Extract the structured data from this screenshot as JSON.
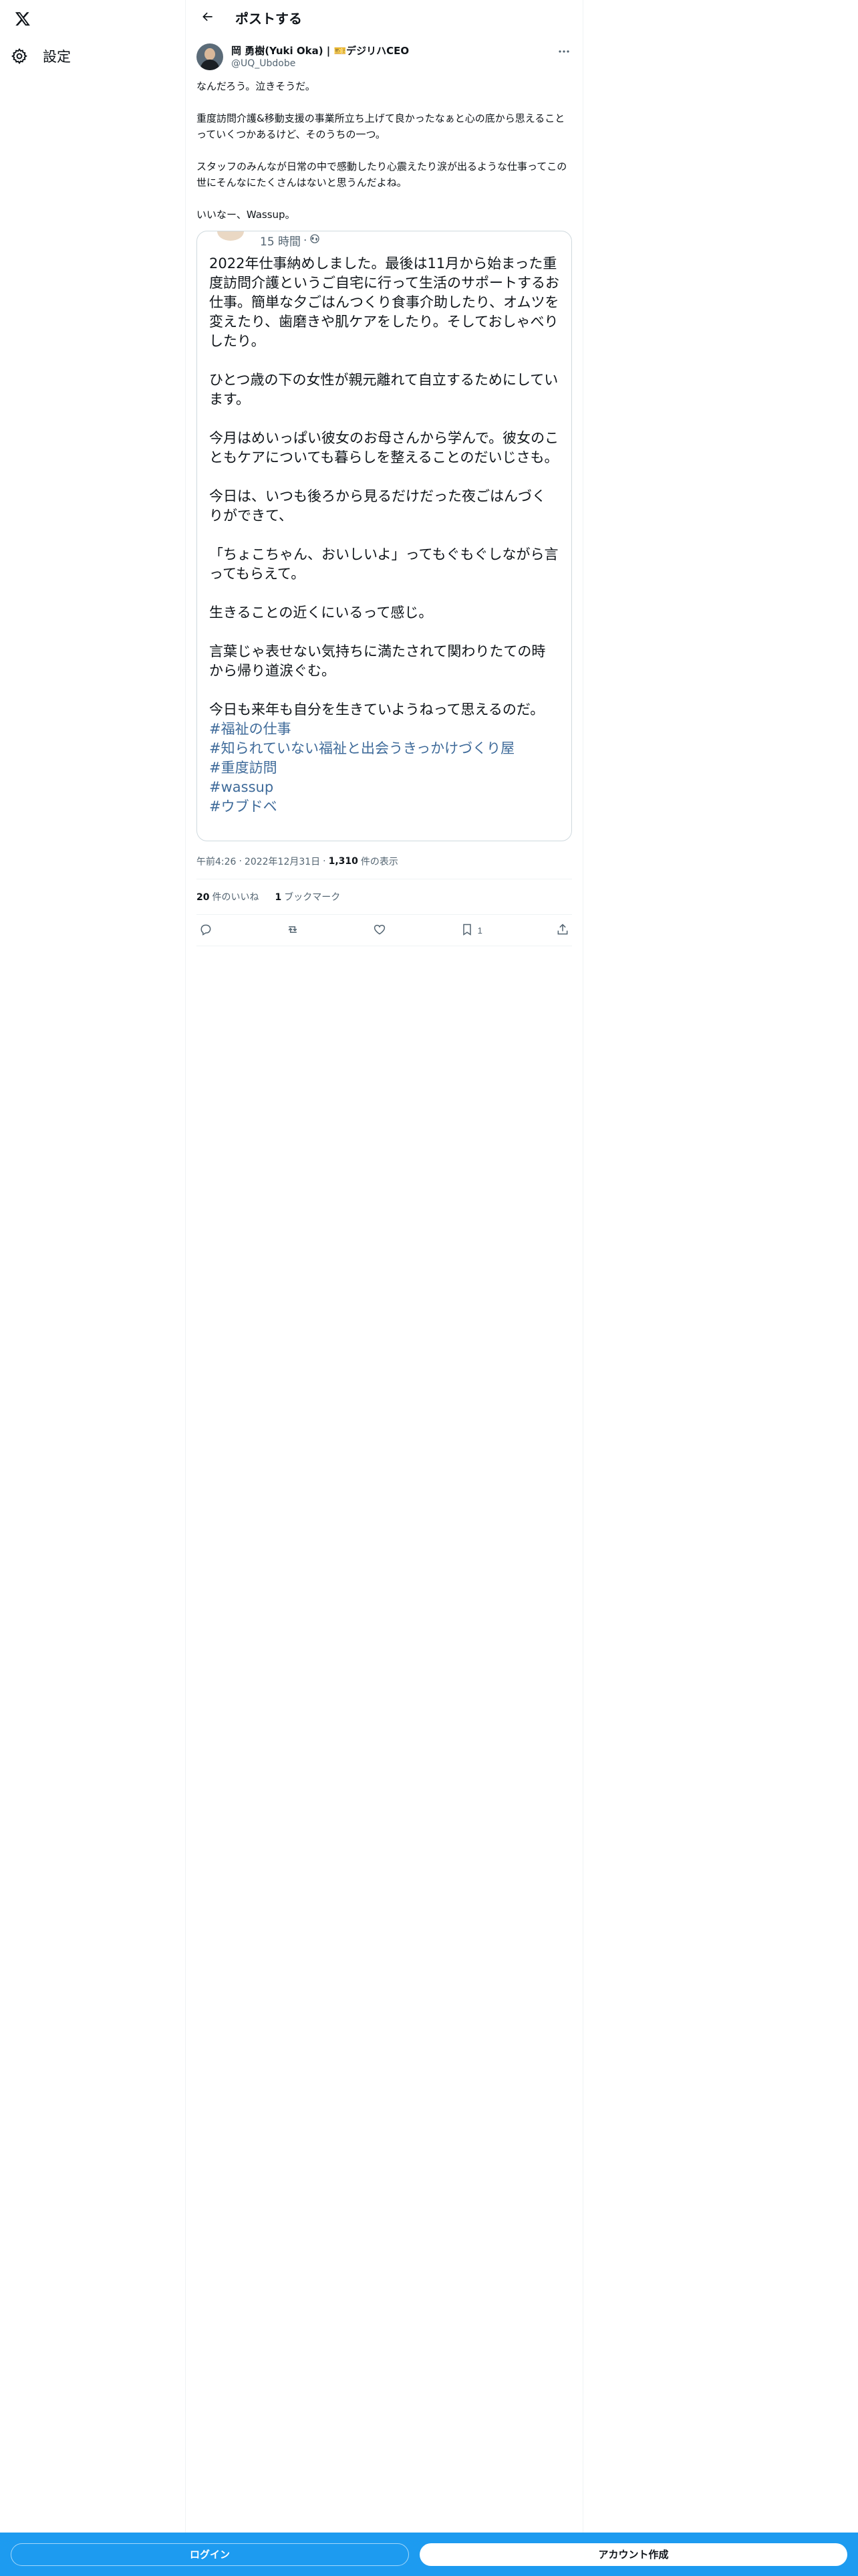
{
  "nav": {
    "logo_icon": "x-logo-icon",
    "settings_icon": "gear-icon",
    "settings_label": "設定"
  },
  "header": {
    "back_icon": "arrow-left-icon",
    "title": "ポストする"
  },
  "post": {
    "author": {
      "display_name": "岡 勇樹(Yuki Oka) | 🎫デジリハCEO",
      "handle": "@UQ_Ubdobe"
    },
    "more_icon": "more-horizontal-icon",
    "text": "なんだろう。泣きそうだ。\n\n重度訪問介護&移動支援の事業所立ち上げて良かったなぁと心の底から思えることっていくつかあるけど、そのうちの一つ。\n\nスタッフのみんなが日常の中で感動したり心震えたり涙が出るような仕事ってこの世にそんなにたくさんはないと思うんだよね。\n\nいいなー、Wassup。",
    "quote": {
      "time": "15 時間",
      "separator": "·",
      "globe_icon": "globe-icon",
      "text": "2022年仕事納めしました。最後は11月から始まった重度訪問介護というご自宅に行って生活のサポートするお仕事。簡単な夕ごはんつくり食事介助したり、オムツを変えたり、歯磨きや肌ケアをしたり。そしておしゃべりしたり。\n\nひとつ歳の下の女性が親元離れて自立するためにしています。\n\n今月はめいっぱい彼女のお母さんから学んで。彼女のこともケアについても暮らしを整えることのだいじさも。\n\n今日は、いつも後ろから見るだけだった夜ごはんづくりができて、\n\n「ちょこちゃん、おいしいよ」ってもぐもぐしながら言ってもらえて。\n\n生きることの近くにいるって感じ。\n\n言葉じゃ表せない気持ちに満たされて関わりたての時から帰り道涙ぐむ。\n\n今日も来年も自分を生きていようねって思えるのだ。\n",
      "hashtags": [
        "#福祉の仕事",
        "#知られていない福祉と出会うきっかけづくり屋",
        "#重度訪問",
        "#wassup",
        "#ウブドベ"
      ]
    },
    "meta": {
      "time": "午前4:26",
      "dot1": "·",
      "date": "2022年12月31日",
      "dot2": "·",
      "views_count": "1,310",
      "views_label": "件の表示"
    },
    "stats": {
      "likes_count": "20",
      "likes_label": "件のいいね",
      "bookmarks_count": "1",
      "bookmarks_label": "ブックマーク"
    },
    "actions": {
      "reply_icon": "reply-icon",
      "repost_icon": "repost-icon",
      "like_icon": "heart-icon",
      "bookmark_icon": "bookmark-icon",
      "bookmark_count": "1",
      "share_icon": "share-icon"
    }
  },
  "bottom_bar": {
    "login_label": "ログイン",
    "signup_label": "アカウント作成",
    "bar_color": "#1d9bf0"
  }
}
